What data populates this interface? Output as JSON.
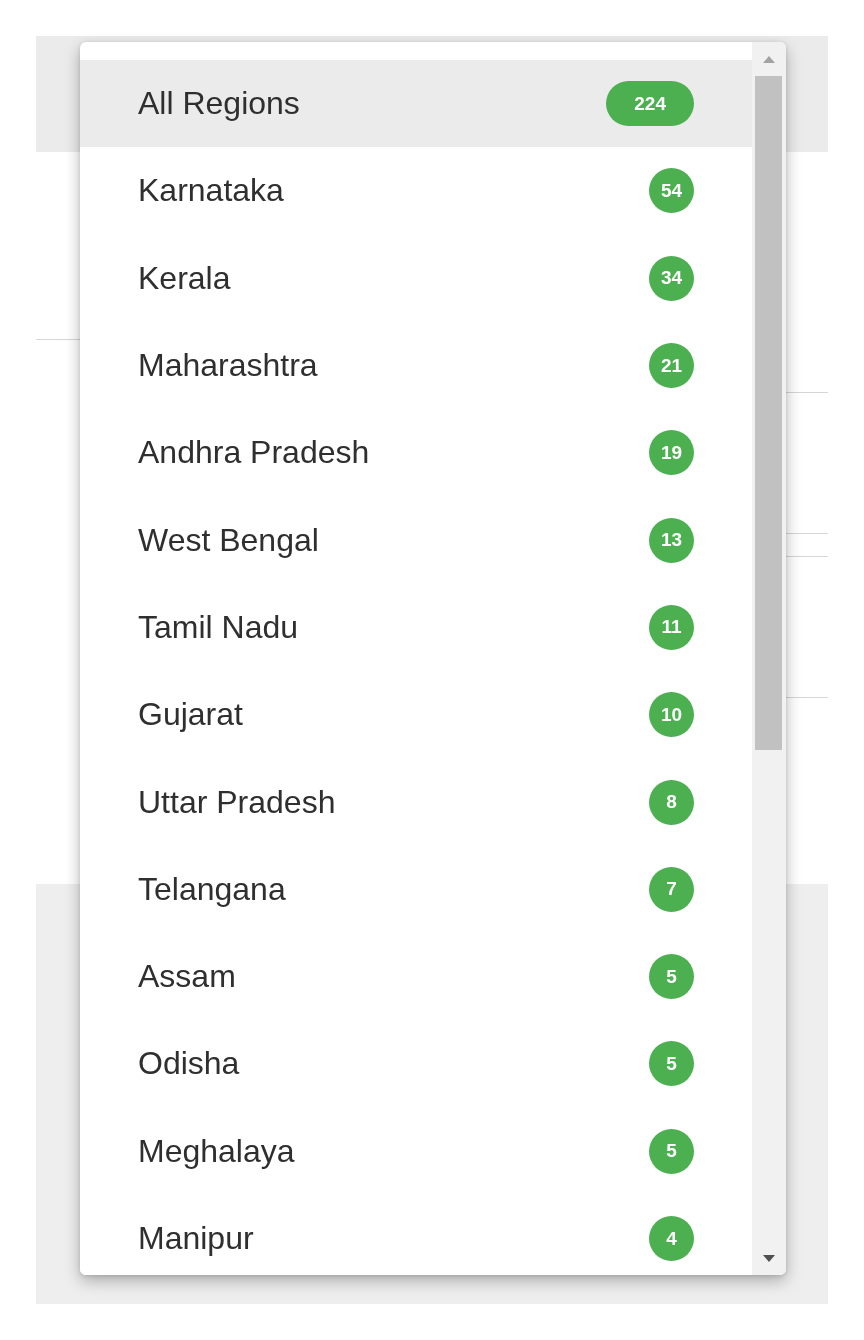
{
  "menu": {
    "items": [
      {
        "label": "All Regions",
        "count": "224",
        "selected": true
      },
      {
        "label": "Karnataka",
        "count": "54",
        "selected": false
      },
      {
        "label": "Kerala",
        "count": "34",
        "selected": false
      },
      {
        "label": "Maharashtra",
        "count": "21",
        "selected": false
      },
      {
        "label": "Andhra Pradesh",
        "count": "19",
        "selected": false
      },
      {
        "label": "West Bengal",
        "count": "13",
        "selected": false
      },
      {
        "label": "Tamil Nadu",
        "count": "11",
        "selected": false
      },
      {
        "label": "Gujarat",
        "count": "10",
        "selected": false
      },
      {
        "label": "Uttar Pradesh",
        "count": "8",
        "selected": false
      },
      {
        "label": "Telangana",
        "count": "7",
        "selected": false
      },
      {
        "label": "Assam",
        "count": "5",
        "selected": false
      },
      {
        "label": "Odisha",
        "count": "5",
        "selected": false
      },
      {
        "label": "Meghalaya",
        "count": "5",
        "selected": false
      },
      {
        "label": "Manipur",
        "count": "4",
        "selected": false
      }
    ]
  }
}
